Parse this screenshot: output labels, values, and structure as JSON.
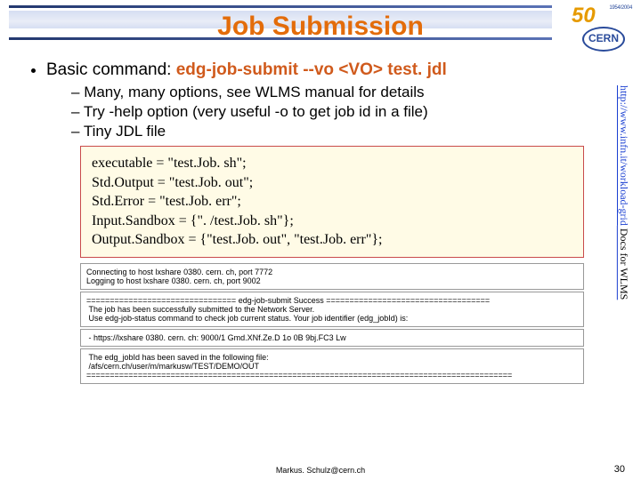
{
  "title": "Job Submission",
  "logo": {
    "ribbon": "50",
    "years": "1954/2004",
    "org": "CERN"
  },
  "bullet": {
    "prefix": "Basic command: ",
    "command": "edg-job-submit  --vo <VO> test. jdl",
    "subs": [
      "Many, many options, see WLMS manual for details",
      "Try -help option (very useful -o to get job id in a file)",
      "Tiny JDL file"
    ]
  },
  "jdl": [
    "executable = \"test.Job. sh\";",
    "Std.Output = \"test.Job. out\";",
    "Std.Error = \"test.Job. err\";",
    "Input.Sandbox = {\". /test.Job. sh\"};",
    "Output.Sandbox = {\"test.Job. out\", \"test.Job. err\"};"
  ],
  "output": {
    "b1": "Connecting to host lxshare 0380. cern. ch, port 7772\nLogging to host lxshare 0380. cern. ch, port 9002",
    "b2": "================================ edg-job-submit Success ===================================\n The job has been successfully submitted to the Network Server.\n Use edg-job-status command to check job current status. Your job identifier (edg_jobId) is:",
    "b3": " - https://lxshare 0380. cern. ch: 9000/1 Gmd.XNf.Ze.D 1o 0B 9bj.FC3 Lw",
    "b4": " The edg_jobId has been saved in the following file:\n /afs/cern.ch/user/m/markusw/TEST/DEMO/OUT\n==========================================================================================="
  },
  "sidelink": {
    "url": "http://www.infn.it/workload-grid",
    "tail": "  Docs for WLMS"
  },
  "footer": {
    "email": "Markus. Schulz@cern.ch",
    "page": "30"
  }
}
